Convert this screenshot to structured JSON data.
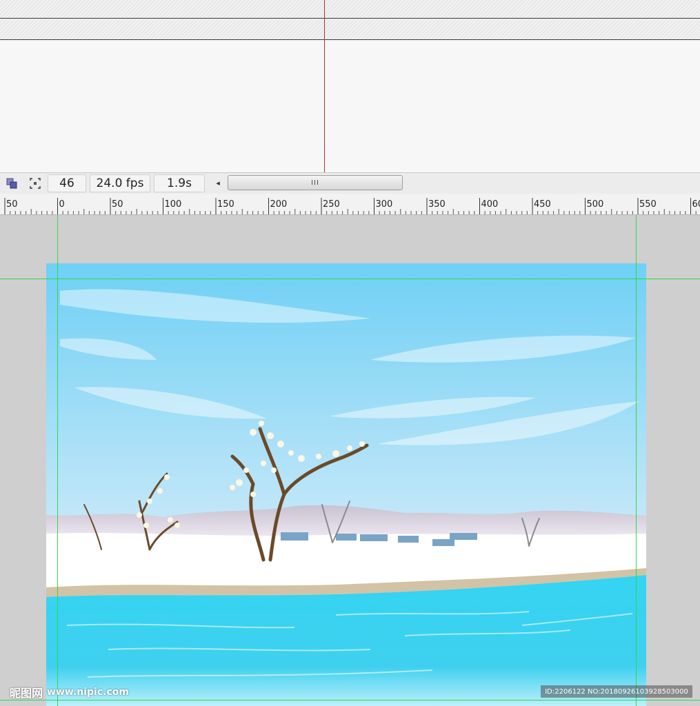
{
  "status": {
    "frame_number": "46",
    "frame_rate": "24.0 fps",
    "elapsed_time": "1.9s",
    "scroll_grip": "III"
  },
  "ruler": {
    "labels": [
      "50",
      "0",
      "50",
      "100",
      "150",
      "200",
      "250",
      "300",
      "350",
      "400",
      "450",
      "500",
      "550",
      "60"
    ]
  },
  "icons": {
    "onion_skin": "onion-skin-icon",
    "edit_multiple_frames": "edit-multiple-frames-icon",
    "scroll_left": "arrow-left-icon"
  },
  "colors": {
    "sky_top": "#6fd0f5",
    "sky_bottom": "#eef6fc",
    "water": "#2fd2f0",
    "guide": "#2fd84a",
    "playhead": "#b03030"
  },
  "watermark": {
    "site_name": "昵图网",
    "site_url": "www.nipic.com",
    "image_id": "ID:2206122 NO:20180926103928503000"
  }
}
